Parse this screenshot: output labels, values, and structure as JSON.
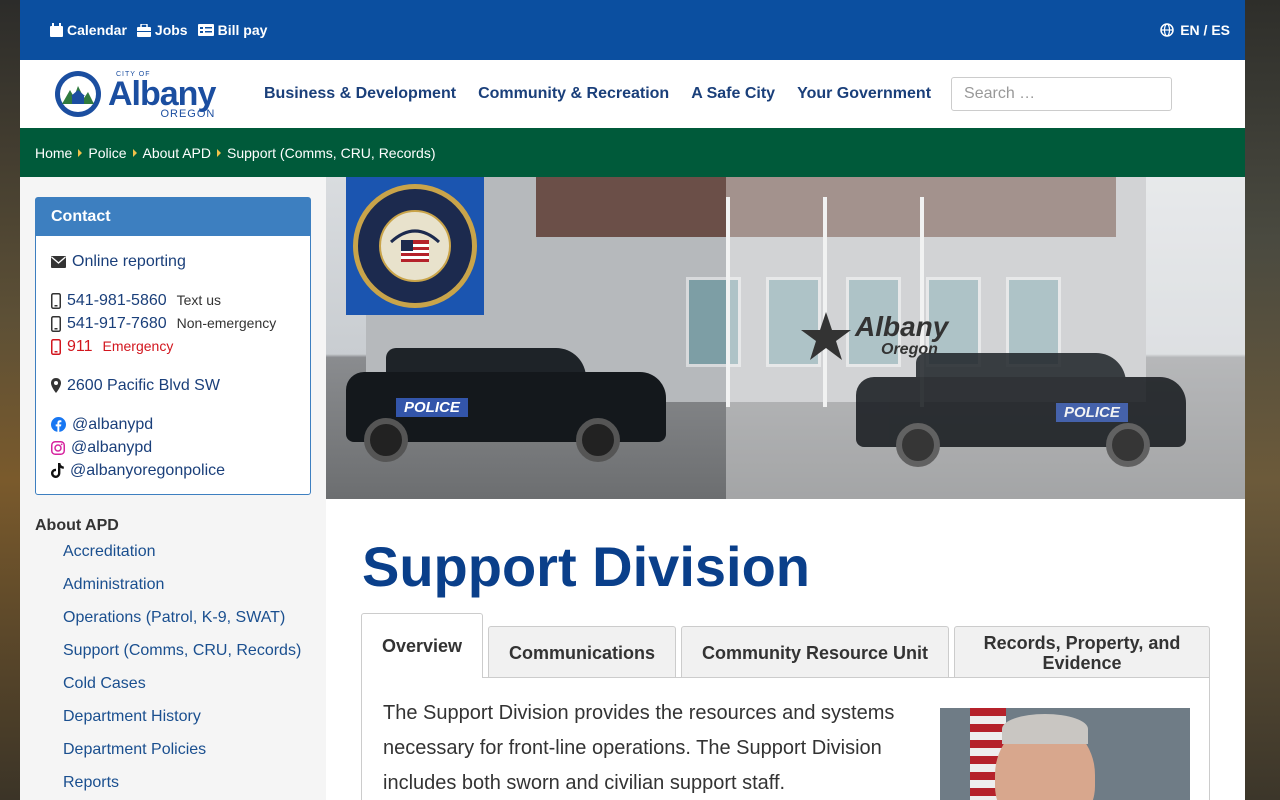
{
  "utility_bar": {
    "links": [
      {
        "label": "Calendar",
        "icon": "calendar-icon"
      },
      {
        "label": "Jobs",
        "icon": "briefcase-icon"
      },
      {
        "label": "Bill pay",
        "icon": "bill-icon"
      }
    ],
    "language": "EN / ES"
  },
  "header": {
    "logo": {
      "city": "CITY OF",
      "name": "Albany",
      "state": "OREGON"
    },
    "nav": [
      "Business & Development",
      "Community & Recreation",
      "A Safe City",
      "Your Government"
    ],
    "search_placeholder": "Search …"
  },
  "breadcrumb": [
    "Home",
    "Police",
    "About APD",
    "Support (Comms, CRU, Records)"
  ],
  "contact": {
    "title": "Contact",
    "online_reporting": "Online reporting",
    "phones": [
      {
        "number": "541-981-5860",
        "note": "Text us"
      },
      {
        "number": "541-917-7680",
        "note": "Non-emergency"
      },
      {
        "number": "911",
        "note": "Emergency"
      }
    ],
    "address": "2600 Pacific Blvd SW",
    "social": [
      {
        "handle": "@albanypd",
        "icon": "facebook-icon"
      },
      {
        "handle": "@albanypd",
        "icon": "instagram-icon"
      },
      {
        "handle": "@albanyoregonpolice",
        "icon": "tiktok-icon"
      }
    ]
  },
  "side_nav": {
    "title": "About APD",
    "items": [
      "Accreditation",
      "Administration",
      "Operations (Patrol, K-9, SWAT)",
      "Support (Comms, CRU, Records)",
      "Cold Cases",
      "Department History",
      "Department Policies",
      "Reports"
    ]
  },
  "hero": {
    "car_label": "POLICE",
    "logo_name": "Albany",
    "logo_state": "Oregon"
  },
  "main": {
    "title": "Support Division",
    "tabs": [
      "Overview",
      "Communications",
      "Community Resource Unit",
      "Records, Property, and Evidence"
    ],
    "intro": "The Support Division provides the resources and systems necessary for front-line operations. The Support Division includes both sworn and civilian support staff."
  },
  "colors": {
    "utility_bar": "#0b4fa0",
    "breadcrumb_bar": "#005a3a",
    "contact_header": "#3d7fc0",
    "title": "#0a3f8a",
    "emergency": "#d2161e"
  }
}
